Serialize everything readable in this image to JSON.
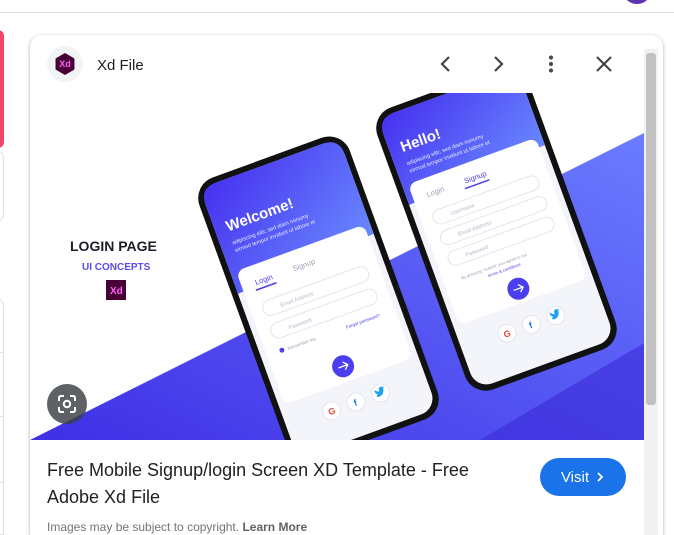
{
  "panel": {
    "source_name": "Xd File",
    "source_logo_text": "Xd",
    "title": "Free Mobile Signup/login Screen XD Template - Free Adobe Xd File",
    "visit_label": "Visit",
    "copyright_text": "Images may be subject to copyright.",
    "learn_more": "Learn More"
  },
  "preview": {
    "heading": "LOGIN PAGE",
    "subheading": "UI CONCEPTS",
    "badge": "Xd",
    "phone_left": {
      "greeting": "Welcome!",
      "tagline_1": "adipiscing elitr, sed diam nonumy",
      "tagline_2": "eirmod tempor invidunt ut labore et",
      "tab_login": "Login",
      "tab_signup": "Signup",
      "field_email": "Email Address",
      "field_password": "Password",
      "remember": "Remember me",
      "forgot": "Forgot password?"
    },
    "phone_right": {
      "greeting": "Hello!",
      "tagline_1": "adipiscing elitr, sed diam nonumy",
      "tagline_2": "eirmod tempor invidunt ut labore et",
      "tab_login": "Login",
      "tab_signup": "Signup",
      "field_username": "Username",
      "field_email": "Email Address",
      "field_password": "Password",
      "terms_1": "By pressing \"submit\" you agree to our",
      "terms_2": "terms & conditions"
    },
    "social_facebook": "f"
  },
  "colors": {
    "accent_blue": "#1a73e8",
    "brand_purple": "#4a3ef0",
    "xd_dark": "#470137",
    "xd_pink": "#ff61f6"
  },
  "icons": [
    "xd-logo-icon",
    "chevron-left-icon",
    "chevron-right-icon",
    "more-vert-icon",
    "close-icon",
    "google-lens-icon",
    "chevron-right-small-icon",
    "google-icon",
    "facebook-icon",
    "twitter-icon"
  ]
}
